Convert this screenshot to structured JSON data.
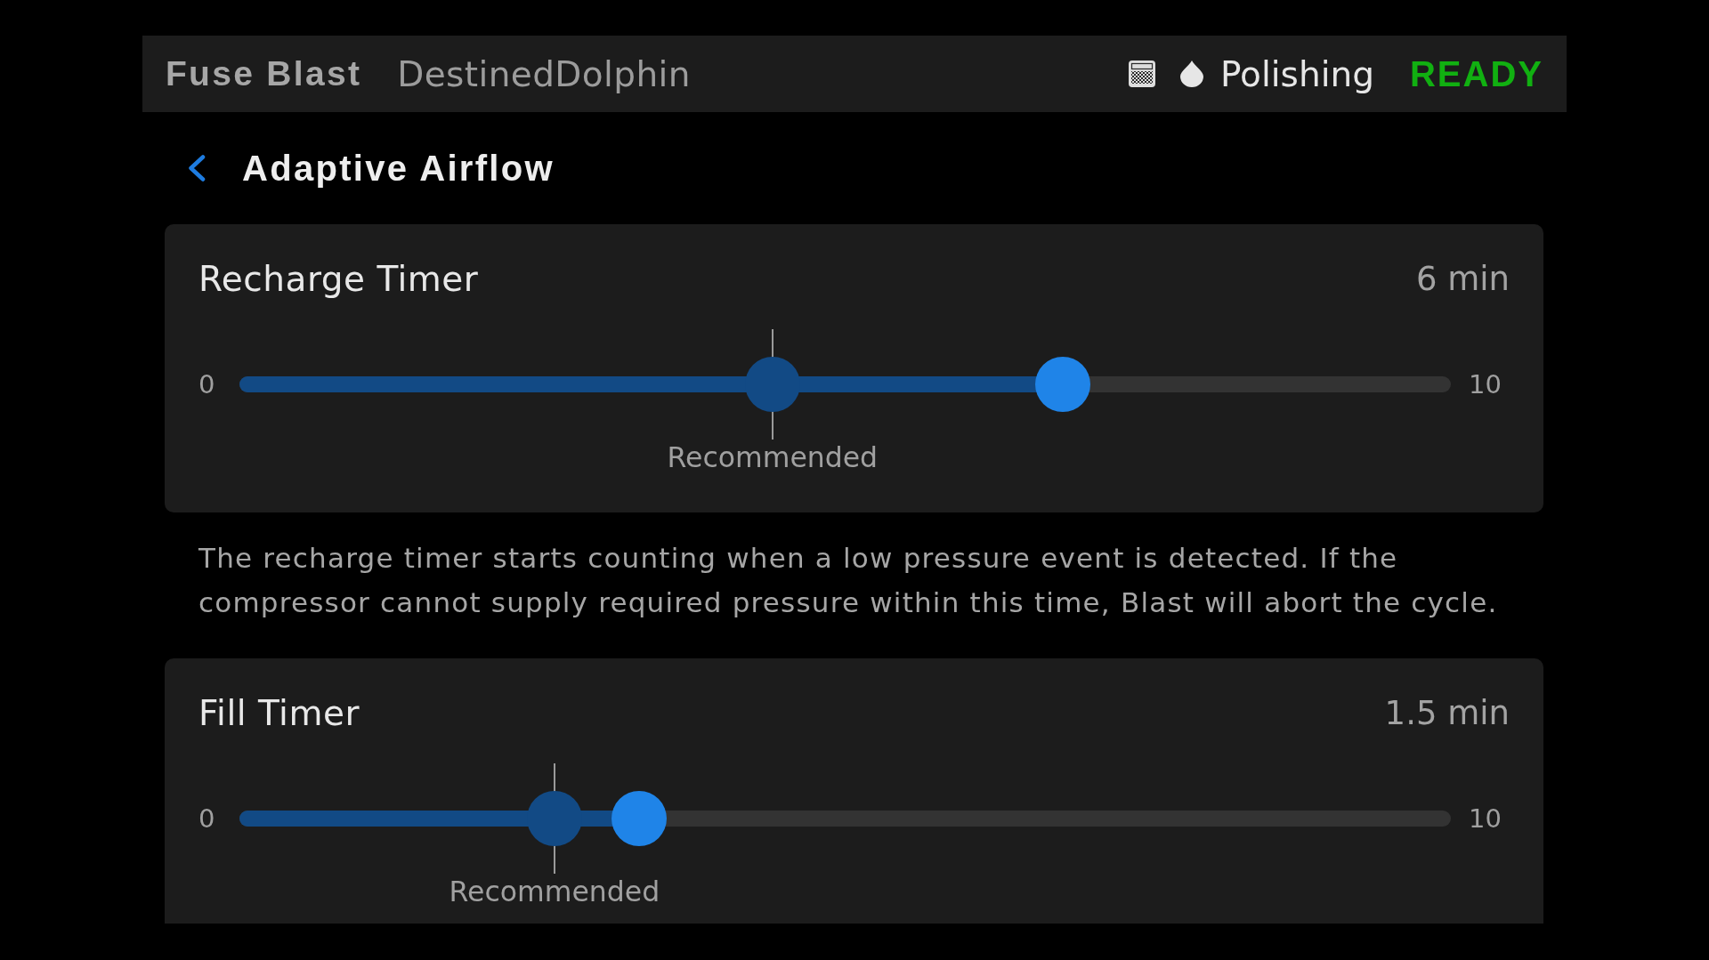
{
  "header": {
    "app_name": "Fuse Blast",
    "device_name": "DestinedDolphin",
    "mode": "Polishing",
    "status": "READY"
  },
  "page": {
    "title": "Adaptive Airflow"
  },
  "settings": [
    {
      "title": "Recharge Timer",
      "value": "6 min",
      "slider": {
        "min_label": "0",
        "max_label": "10",
        "level": 0.68,
        "recommended": {
          "label": "Recommended",
          "level": 0.44
        }
      },
      "description": "The recharge timer starts counting when a low pressure event is detected. If the compressor cannot supply required pressure within this time, Blast will abort the cycle."
    },
    {
      "title": "Fill Timer",
      "value": "1.5 min",
      "slider": {
        "min_label": "0",
        "max_label": "10",
        "level": 0.33,
        "recommended": {
          "label": "Recommended",
          "level": 0.26
        }
      }
    }
  ]
}
